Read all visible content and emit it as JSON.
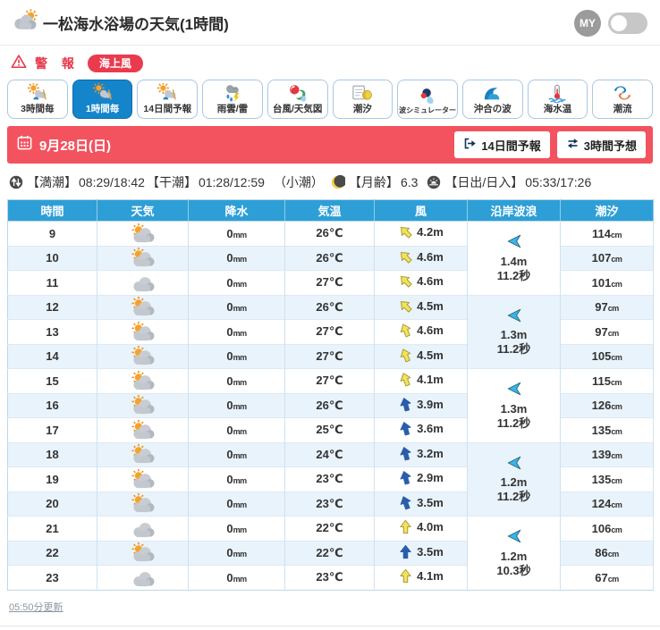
{
  "header": {
    "title": "一松海水浴場の天気(1時間)",
    "my_label": "MY",
    "weather_icon": "sun-behind-cloud",
    "my_toggle_state": "off"
  },
  "warning": {
    "alert_label": "警 報",
    "badge_label": "海上風"
  },
  "tabs": [
    {
      "key": "3hourly",
      "label": "3時間毎",
      "icon": "weather-mix-icon",
      "selected": false
    },
    {
      "key": "1hourly",
      "label": "1時間毎",
      "icon": "weather-mix-icon",
      "selected": true
    },
    {
      "key": "14day",
      "label": "14日間予報",
      "icon": "weather-mix-icon",
      "selected": false
    },
    {
      "key": "rain-radar",
      "label": "雨雲/雷",
      "icon": "rain-lightning-icon",
      "selected": false
    },
    {
      "key": "typhoon",
      "label": "台風/天気図",
      "icon": "typhoon-map-icon",
      "selected": false
    },
    {
      "key": "tide",
      "label": "潮汐",
      "icon": "tide-calendar-icon",
      "selected": false
    },
    {
      "key": "wave-simulator",
      "label": "波シミュレーター",
      "icon": "wave-simulator-icon",
      "selected": false
    },
    {
      "key": "offshore-waves",
      "label": "沖合の波",
      "icon": "offshore-wave-icon",
      "selected": false
    },
    {
      "key": "sea-temp",
      "label": "海水温",
      "icon": "sea-temp-icon",
      "selected": false
    },
    {
      "key": "current",
      "label": "潮流",
      "icon": "current-icon",
      "selected": false
    }
  ],
  "date_bar": {
    "date": "9月28日(日)",
    "buttons": [
      {
        "key": "fourteen-day-forecast",
        "label": "14日間予報",
        "icon": "export-icon"
      },
      {
        "key": "three-hour-forecast",
        "label": "3時間予想",
        "icon": "switch-icon"
      }
    ]
  },
  "tide_info": {
    "high_tide_label": "【満潮】",
    "high_tide": "08:29/18:42",
    "low_tide_label": "【干潮】",
    "low_tide": "01:28/12:59",
    "tide_type": "（小潮）",
    "moon_age_label": "【月齢】",
    "moon_age": "6.3",
    "sunrise_label": "【日出/日入】",
    "sunrise_sunset": "05:33/17:26"
  },
  "table": {
    "columns": [
      "時間",
      "天気",
      "降水",
      "気温",
      "風",
      "沿岸波浪",
      "潮汐"
    ],
    "rain_unit": "mm",
    "tide_unit": "cm",
    "rows": [
      {
        "hour": "9",
        "weather": "partly-cloudy",
        "rain": "0",
        "temp": "26℃",
        "wind": {
          "speed": "4.2m",
          "color": "yellow",
          "dir_deg": -45
        },
        "tide": "114"
      },
      {
        "hour": "10",
        "weather": "partly-cloudy",
        "rain": "0",
        "temp": "26℃",
        "wind": {
          "speed": "4.6m",
          "color": "yellow",
          "dir_deg": -45
        },
        "tide": "107"
      },
      {
        "hour": "11",
        "weather": "cloudy",
        "rain": "0",
        "temp": "27℃",
        "wind": {
          "speed": "4.6m",
          "color": "yellow",
          "dir_deg": -45
        },
        "tide": "101"
      },
      {
        "hour": "12",
        "weather": "partly-cloudy",
        "rain": "0",
        "temp": "26℃",
        "wind": {
          "speed": "4.5m",
          "color": "yellow",
          "dir_deg": -45
        },
        "tide": "97"
      },
      {
        "hour": "13",
        "weather": "partly-cloudy",
        "rain": "0",
        "temp": "27℃",
        "wind": {
          "speed": "4.6m",
          "color": "yellow",
          "dir_deg": -22
        },
        "tide": "97"
      },
      {
        "hour": "14",
        "weather": "partly-cloudy",
        "rain": "0",
        "temp": "27℃",
        "wind": {
          "speed": "4.5m",
          "color": "yellow",
          "dir_deg": -22
        },
        "tide": "105"
      },
      {
        "hour": "15",
        "weather": "partly-cloudy",
        "rain": "0",
        "temp": "27℃",
        "wind": {
          "speed": "4.1m",
          "color": "yellow",
          "dir_deg": -20
        },
        "tide": "115"
      },
      {
        "hour": "16",
        "weather": "partly-cloudy",
        "rain": "0",
        "temp": "26℃",
        "wind": {
          "speed": "3.9m",
          "color": "blue",
          "dir_deg": -15
        },
        "tide": "126"
      },
      {
        "hour": "17",
        "weather": "partly-cloudy",
        "rain": "0",
        "temp": "25℃",
        "wind": {
          "speed": "3.6m",
          "color": "blue",
          "dir_deg": -15
        },
        "tide": "135"
      },
      {
        "hour": "18",
        "weather": "partly-cloudy",
        "rain": "0",
        "temp": "24℃",
        "wind": {
          "speed": "3.2m",
          "color": "blue",
          "dir_deg": -15
        },
        "tide": "139"
      },
      {
        "hour": "19",
        "weather": "partly-cloudy",
        "rain": "0",
        "temp": "23℃",
        "wind": {
          "speed": "2.9m",
          "color": "blue",
          "dir_deg": -15
        },
        "tide": "135"
      },
      {
        "hour": "20",
        "weather": "partly-cloudy",
        "rain": "0",
        "temp": "23℃",
        "wind": {
          "speed": "3.5m",
          "color": "blue",
          "dir_deg": -20
        },
        "tide": "124"
      },
      {
        "hour": "21",
        "weather": "cloudy",
        "rain": "0",
        "temp": "22℃",
        "wind": {
          "speed": "4.0m",
          "color": "yellow",
          "dir_deg": 0
        },
        "tide": "106"
      },
      {
        "hour": "22",
        "weather": "partly-cloudy",
        "rain": "0",
        "temp": "22℃",
        "wind": {
          "speed": "3.5m",
          "color": "blue",
          "dir_deg": 0
        },
        "tide": "86"
      },
      {
        "hour": "23",
        "weather": "cloudy",
        "rain": "0",
        "temp": "23℃",
        "wind": {
          "speed": "4.1m",
          "color": "yellow",
          "dir_deg": 0
        },
        "tide": "67"
      }
    ],
    "wave_groups": [
      {
        "hours": "9-11",
        "height": "1.4m",
        "period": "11.2秒",
        "dir": "left"
      },
      {
        "hours": "12-14",
        "height": "1.3m",
        "period": "11.2秒",
        "dir": "left"
      },
      {
        "hours": "15-17",
        "height": "1.3m",
        "period": "11.2秒",
        "dir": "left"
      },
      {
        "hours": "18-20",
        "height": "1.2m",
        "period": "11.2秒",
        "dir": "left"
      },
      {
        "hours": "21-23",
        "height": "1.2m",
        "period": "10.3秒",
        "dir": "left"
      }
    ]
  },
  "footer": {
    "updated": "05:50分更新"
  },
  "colors": {
    "accent_red": "#f3535f",
    "badge_red": "#ea3b4e",
    "table_header_blue": "#2e9fd6",
    "selected_tab_blue": "#1585cb",
    "row_stripe": "#e9f3fb",
    "wind_yellow": "#f2e35e",
    "wind_blue": "#2a5dab",
    "wave_cyan": "#38b5e6"
  }
}
